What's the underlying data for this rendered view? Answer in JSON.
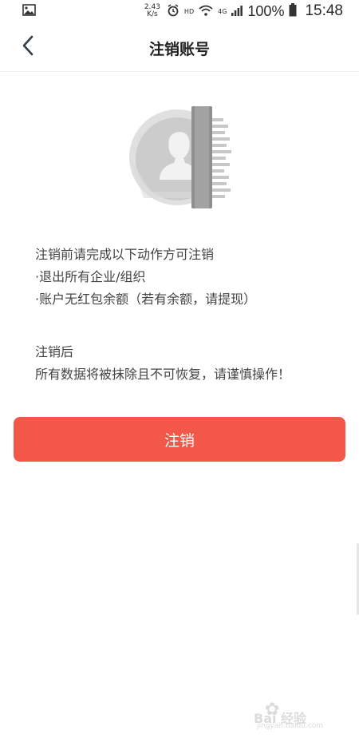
{
  "status_bar": {
    "net_speed_value": "2.43",
    "net_speed_unit": "K/s",
    "hd": "HD",
    "net_type": "4G",
    "battery": "100%",
    "time": "15:48"
  },
  "header": {
    "title": "注销账号"
  },
  "content": {
    "pre_title": "注销前请完成以下动作方可注销",
    "steps": [
      "·退出所有企业/组织",
      "·账户无红包余额（若有余额，请提现）"
    ],
    "after_title": "注销后",
    "after_text": "所有数据将被抹除且不可恢复，请谨慎操作！"
  },
  "button": {
    "label": "注销"
  },
  "watermark": {
    "text": "Bai 经验",
    "sub": "jingyan.baidu.com"
  },
  "colors": {
    "accent": "#f3574a",
    "background": "#ffffff",
    "illustration_gray": "#bdbdbd"
  }
}
